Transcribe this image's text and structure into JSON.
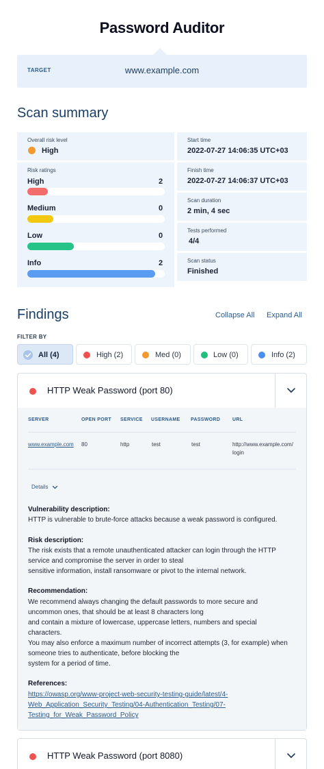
{
  "app": {
    "title": "Password Auditor"
  },
  "target": {
    "label": "TARGET",
    "value": "www.example.com"
  },
  "summary": {
    "heading": "Scan summary",
    "overall": {
      "label": "Overall risk level",
      "value": "High",
      "color": "#f29a2e"
    },
    "ratings_label": "Risk ratings",
    "ratings": [
      {
        "label": "High",
        "count": "2",
        "fraction": 0.15,
        "color": "#f46d6d"
      },
      {
        "label": "Medium",
        "count": "0",
        "fraction": 0.19,
        "color": "#f2c811"
      },
      {
        "label": "Low",
        "count": "0",
        "fraction": 0.34,
        "color": "#27c48a"
      },
      {
        "label": "Info",
        "count": "2",
        "fraction": 0.93,
        "color": "#5a9cf2"
      }
    ],
    "right": [
      {
        "label": "Start time",
        "value": "2022-07-27 14:06:35 UTC+03"
      },
      {
        "label": "Finish time",
        "value": "2022-07-27 14:06:37 UTC+03"
      },
      {
        "label": "Scan duration",
        "value": "2 min, 4 sec"
      },
      {
        "label": "Tests performed",
        "value": "4/4"
      },
      {
        "label": "Scan status",
        "value": "Finished"
      }
    ]
  },
  "findings": {
    "heading": "Findings",
    "collapse_all": "Collapse All",
    "expand_all": "Expand All",
    "filter_label": "FILTER BY",
    "filters": [
      {
        "label": "All (4)",
        "color": "#9fbee6",
        "active": true
      },
      {
        "label": "High (2)",
        "color": "#ef5350"
      },
      {
        "label": "Med (0)",
        "color": "#f29a2e"
      },
      {
        "label": "Low (0)",
        "color": "#1fbf7e"
      },
      {
        "label": "Info (2)",
        "color": "#4a8ff0"
      }
    ],
    "items": [
      {
        "title": "HTTP Weak Password (port 80)",
        "severity_color": "#ef5350",
        "columns": [
          "SERVER",
          "OPEN PORT",
          "SERVICE",
          "USERNAME",
          "PASSWORD",
          "URL"
        ],
        "row": {
          "server": "www.example.com",
          "port": "80",
          "service": "http",
          "username": "test",
          "password": "test",
          "url_line1": "http://www.example.com/",
          "url_line2": "login"
        },
        "details_label": "Details",
        "vuln_title": "Vulnerability description:",
        "vuln_text": "HTTP is vulnerable to brute-force attacks because a weak password is configured.",
        "risk_title": "Risk description:",
        "risk_lines": [
          "The risk exists that a remote unauthenticated attacker can login through the HTTP",
          "service and compromise the server in order to steal",
          "sensitive information, install ransomware or pivot to the internal network."
        ],
        "rec_title": "Recommendation:",
        "rec_lines": [
          "We recommend always changing the default passwords to more secure and",
          "uncommon ones, that should be at least 8 characters long",
          "and contain a mixture of lowercase, uppercase letters, numbers and special",
          "characters.",
          "You may also enforce a maximum number of incorrect attempts (3, for example) when",
          "someone tries to authenticate, before blocking the",
          "system for a period of time."
        ],
        "ref_title": "References:",
        "ref_lines": [
          "https://owasp.org/www-project-web-security-testing-guide/latest/4-",
          "Web_Application_Security_Testing/04-Authentication_Testing/07-",
          "Testing_for_Weak_Password_Policy"
        ]
      },
      {
        "title": "HTTP Weak Password (port 8080)",
        "severity_color": "#ef5350"
      }
    ]
  }
}
